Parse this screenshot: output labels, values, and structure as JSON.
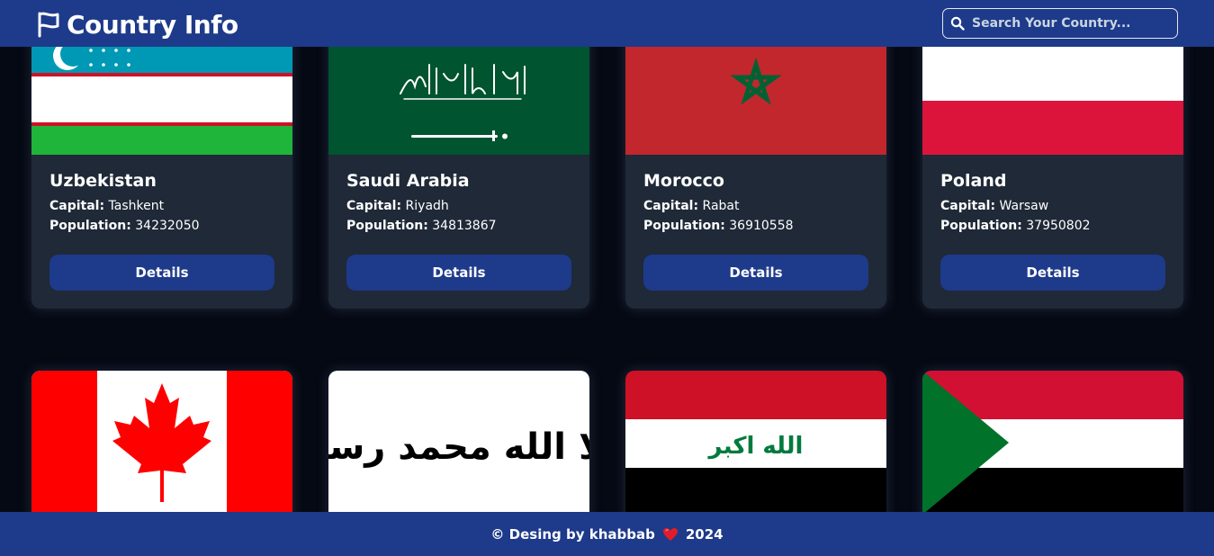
{
  "header": {
    "title": "Country Info",
    "logo_icon": "flag-icon",
    "search_placeholder": "Search Your Country...",
    "search_icon": "search-icon"
  },
  "cards": [
    {
      "name": "Uzbekistan",
      "capital_label": "Capital:",
      "capital": "Tashkent",
      "population_label": "Population:",
      "population": "34232050",
      "button": "Details"
    },
    {
      "name": "Saudi Arabia",
      "capital_label": "Capital:",
      "capital": "Riyadh",
      "population_label": "Population:",
      "population": "34813867",
      "button": "Details"
    },
    {
      "name": "Morocco",
      "capital_label": "Capital:",
      "capital": "Rabat",
      "population_label": "Population:",
      "population": "36910558",
      "button": "Details"
    },
    {
      "name": "Poland",
      "capital_label": "Capital:",
      "capital": "Warsaw",
      "population_label": "Population:",
      "population": "37950802",
      "button": "Details"
    }
  ],
  "lower_cards": [
    {
      "flag": "canada-flag"
    },
    {
      "flag": "afghanistan-flag",
      "flag_text": "لا إله إلا الله محمد رسول الله"
    },
    {
      "flag": "iraq-flag",
      "flag_text": "الله اكبر"
    },
    {
      "flag": "sudan-flag"
    }
  ],
  "footer": {
    "prefix": "© Desing by khabbab",
    "heart_icon": "heart-icon",
    "year": "2024"
  },
  "colors": {
    "navbar": "#1e3a8a",
    "background": "#050913",
    "card": "#1f2937",
    "button": "#1e3a8a"
  }
}
